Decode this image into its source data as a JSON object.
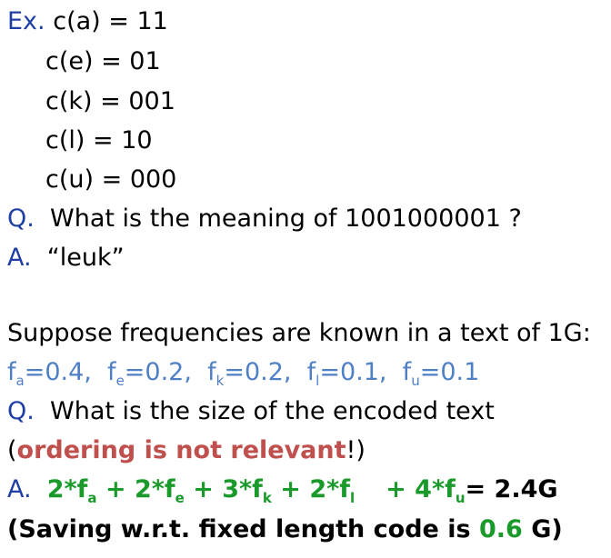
{
  "example": {
    "label": "Ex.",
    "codes": [
      "c(a) = 11",
      "c(e) = 01",
      "c(k) = 001",
      "c(l) = 10",
      "c(u) = 000"
    ]
  },
  "q1": {
    "label": "Q.",
    "text": "What is the meaning of 1001000001 ?"
  },
  "a1": {
    "label": "A.",
    "text": "“leuk”"
  },
  "suppose": "Suppose frequencies are known in a text of 1G:",
  "freqs": [
    {
      "sym": "f",
      "sub": "a",
      "val": "=0.4,"
    },
    {
      "sym": "f",
      "sub": "e",
      "val": "=0.2,"
    },
    {
      "sym": "f",
      "sub": "k",
      "val": "=0.2,"
    },
    {
      "sym": "f",
      "sub": "l",
      "val": "=0.1,"
    },
    {
      "sym": "f",
      "sub": "u",
      "val": "=0.1"
    }
  ],
  "q2": {
    "label": "Q.",
    "text": "What is the size of the encoded text"
  },
  "note": {
    "open": "(",
    "red": "ordering is not relevant",
    "close": "!)"
  },
  "a2": {
    "label": "A.",
    "t1": "2*f",
    "s1": "a",
    "t2": "+ 2*f",
    "s2": "e",
    "t3": "+ 3*f",
    "s3": "k",
    "t4": "+ 2*f",
    "s4": "l",
    "t5": "+ 4*f",
    "s5": "u",
    "result": "= 2.4G"
  },
  "saving": {
    "prefix": "(Saving w.r.t. fixed length code  is ",
    "value": "0.6",
    "suffix": " G)"
  },
  "colors": {
    "label_blue": "#1f3fa6",
    "freq_blue": "#4f80c6",
    "red": "#c0504d",
    "green": "#1a9a2a"
  }
}
